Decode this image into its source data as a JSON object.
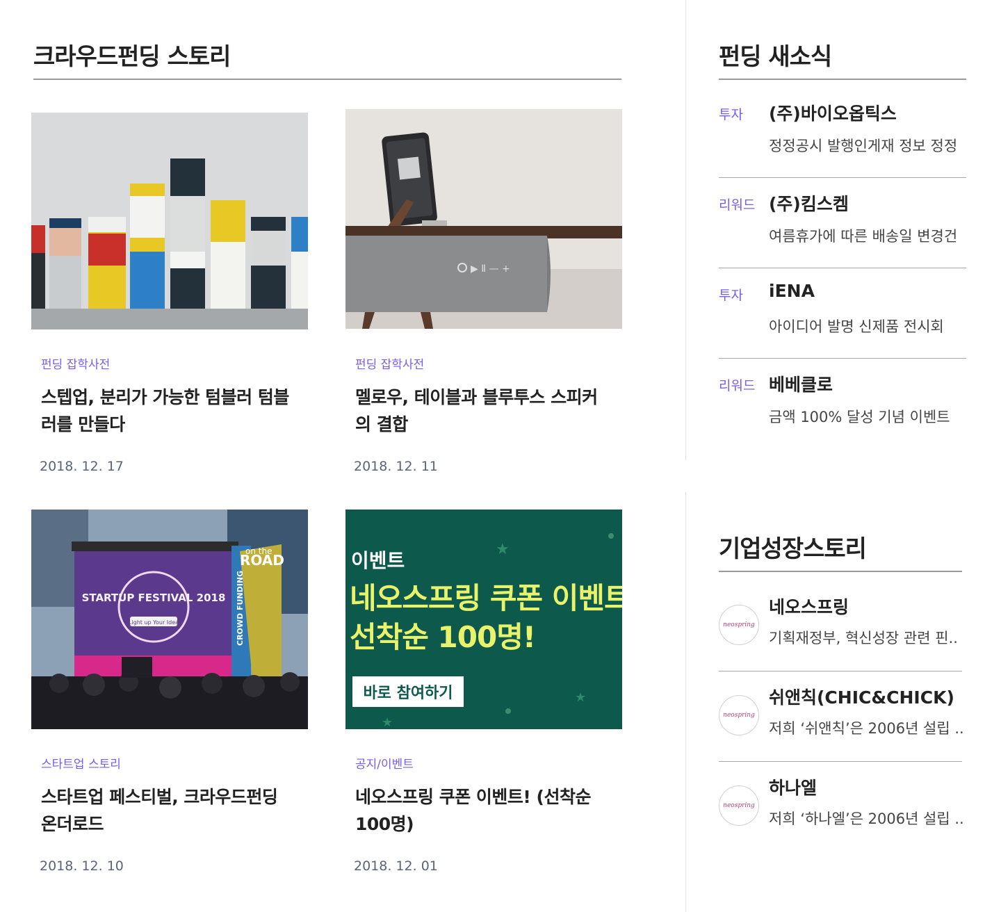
{
  "story": {
    "title": "크라우드펀딩 스토리",
    "cards": [
      {
        "category": "펀딩 잡학사전",
        "title": "스텝업, 분리가 가능한 텀블러 텀블러를 만들다",
        "date": "2018. 12. 17"
      },
      {
        "category": "펀딩 잡학사전",
        "title": "멜로우, 테이블과 블루투스 스피커의 결합",
        "date": "2018. 12. 11"
      },
      {
        "category": "스타트업 스토리",
        "title": "스타트업 페스티벌, 크라우드펀딩 온더로드",
        "date": "2018. 12. 10"
      },
      {
        "category": "공지/이벤트",
        "title": "네오스프링 쿠폰 이벤트! (선착순 100명)",
        "date": "2018. 12. 01"
      }
    ]
  },
  "images": {
    "festival": {
      "sign": "STARTUP FESTIVAL 2018",
      "tagline": "Light up Your Idea",
      "road_small": "on the",
      "road": "ROAD",
      "banner": "CROWD FUNDING"
    },
    "event": {
      "label": "이벤트",
      "headline1": "네오스프링 쿠폰 이벤트",
      "headline2": "선착순 100명!",
      "button": "바로 참여하기"
    }
  },
  "news": {
    "title": "펀딩 새소식",
    "items": [
      {
        "tag": "투자",
        "name": "(주)바이오옵틱스",
        "desc": "정정공시 발행인게재 정보 정정"
      },
      {
        "tag": "리워드",
        "name": "(주)킴스켐",
        "desc": "여름휴가에 따른 배송일 변경건"
      },
      {
        "tag": "투자",
        "name": "iENA",
        "desc": "아이디어 발명 신제품 전시회"
      },
      {
        "tag": "리워드",
        "name": "베베클로",
        "desc": "금액 100% 달성 기념 이벤트"
      }
    ]
  },
  "growth": {
    "title": "기업성장스토리",
    "items": [
      {
        "logo": "neospring",
        "name": "네오스프링",
        "desc": "기획재정부, 혁신성장 관련 핀.."
      },
      {
        "logo": "neospring",
        "name": "쉬앤칙(CHIC&CHICK)",
        "desc": "저희 ‘쉬앤칙’은 2006년 설립 .."
      },
      {
        "logo": "neospring",
        "name": "하나엘",
        "desc": "저희 ‘하나엘’은 2006년 설립 .."
      }
    ]
  },
  "colors": {
    "accent": "#7a5cf0",
    "event_bg": "#0d5a4c",
    "event_text": "#e8f26a"
  }
}
